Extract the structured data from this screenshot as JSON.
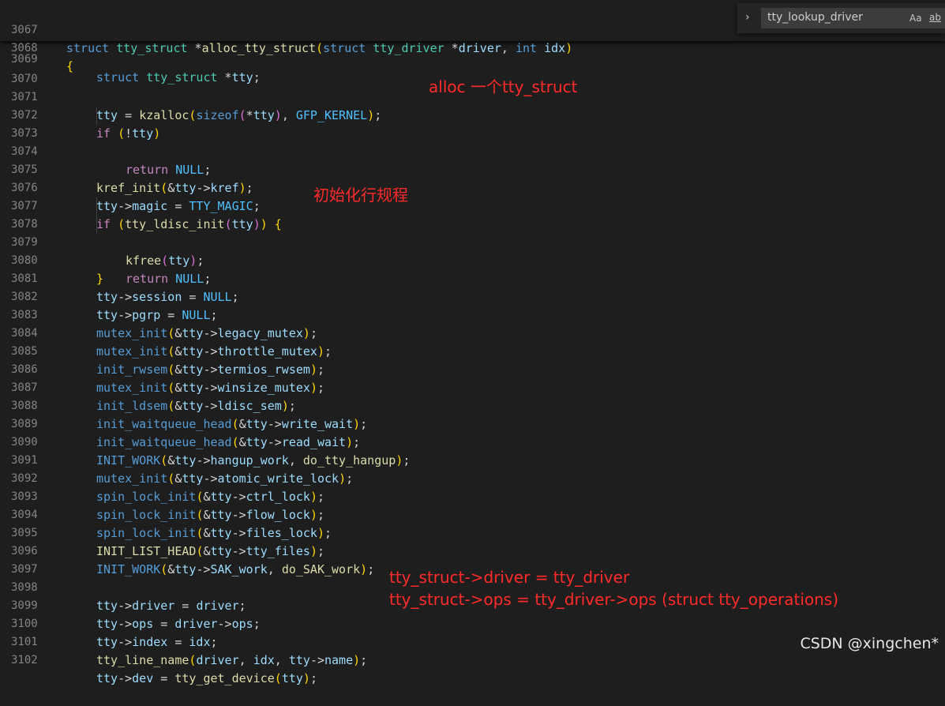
{
  "editor": {
    "sticky": {
      "ln1": "3067",
      "ln2": "3068",
      "ln3": "3069",
      "brace": "{",
      "sig": {
        "kw1": "struct",
        "ty1": "tty_struct",
        "star": " *",
        "fn": "alloc_tty_struct",
        "open": "(",
        "kw2": "struct",
        "ty2": "tty_driver",
        "star2": " *",
        "p1": "driver",
        "comma": ", ",
        "kw3": "int",
        "p2": "idx",
        "close": ")"
      },
      "clip": "struct tty_struct *tty;"
    },
    "lines": {
      "l3070": "3070",
      "l3071": "3071",
      "l3072": "3072",
      "l3073": "3073",
      "l3074": "3074",
      "l3075": "3075",
      "l3076": "3076",
      "l3077": "3077",
      "l3078": "3078",
      "l3079": "3079",
      "l3080": "3080",
      "l3081": "3081",
      "l3082": "3082",
      "l3083": "3083",
      "l3084": "3084",
      "l3085": "3085",
      "l3086": "3086",
      "l3087": "3087",
      "l3088": "3088",
      "l3089": "3089",
      "l3090": "3090",
      "l3091": "3091",
      "l3092": "3092",
      "l3093": "3093",
      "l3094": "3094",
      "l3095": "3095",
      "l3096": "3096",
      "l3097": "3097",
      "l3098": "3098",
      "l3099": "3099",
      "l3100": "3100",
      "l3101": "3101",
      "l3102": "3102"
    }
  },
  "find_widget": {
    "query": "tty_lookup_driver",
    "match_case": "Aa",
    "whole_word": "ab",
    "expand": "›"
  },
  "annotations": {
    "alloc": "alloc 一个tty_struct",
    "ldisc": "初始化行规程",
    "driver": "tty_struct->driver = tty_driver",
    "ops": "tty_struct->ops = tty_driver->ops (struct tty_operations)"
  },
  "watermark": "CSDN @xingchen*"
}
